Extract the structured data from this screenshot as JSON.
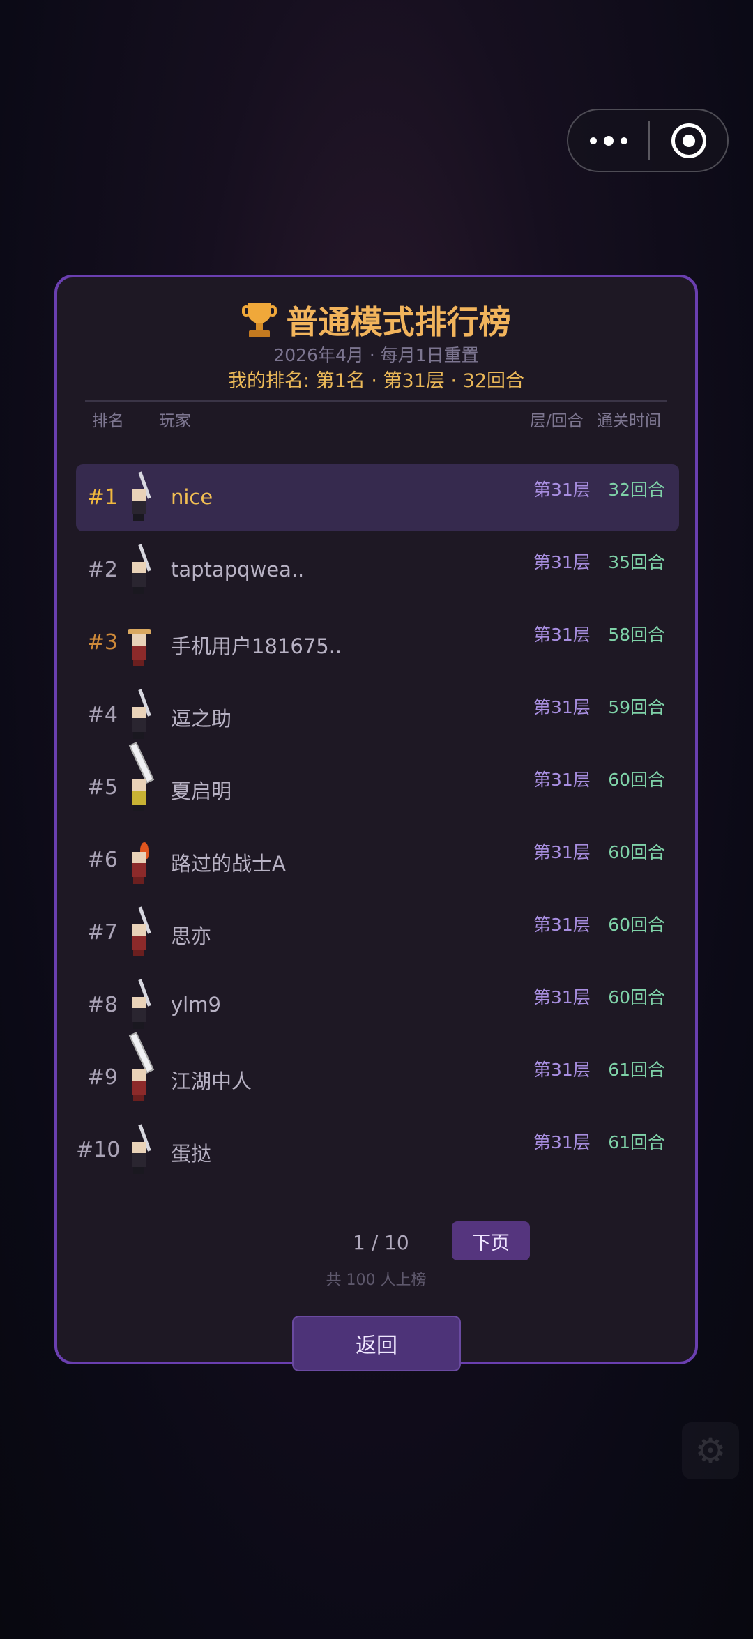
{
  "capsule": {
    "more_icon": "more-dots-icon",
    "close_icon": "target-close-icon"
  },
  "leaderboard": {
    "title": "普通模式排行榜",
    "subtitle": "2026年4月 · 每月1日重置",
    "my_rank": "我的排名: 第1名 · 第31层 · 32回合",
    "headers": {
      "rank": "排名",
      "player": "玩家",
      "floor": "层/回合",
      "time": "通关时间"
    },
    "rows": [
      {
        "rank": "#1",
        "name": "nice",
        "floor": "第31层",
        "round": "32回合"
      },
      {
        "rank": "#2",
        "name": "taptapqwea..",
        "floor": "第31层",
        "round": "35回合"
      },
      {
        "rank": "#3",
        "name": "手机用户181675..",
        "floor": "第31层",
        "round": "58回合"
      },
      {
        "rank": "#4",
        "name": "逗之助",
        "floor": "第31层",
        "round": "59回合"
      },
      {
        "rank": "#5",
        "name": "夏启明",
        "floor": "第31层",
        "round": "60回合"
      },
      {
        "rank": "#6",
        "name": "路过的战士A",
        "floor": "第31层",
        "round": "60回合"
      },
      {
        "rank": "#7",
        "name": "思亦",
        "floor": "第31层",
        "round": "60回合"
      },
      {
        "rank": "#8",
        "name": "ylm9",
        "floor": "第31层",
        "round": "60回合"
      },
      {
        "rank": "#9",
        "name": "江湖中人",
        "floor": "第31层",
        "round": "61回合"
      },
      {
        "rank": "#10",
        "name": "蛋挞",
        "floor": "第31层",
        "round": "61回合"
      }
    ],
    "page": "1 / 10",
    "next_label": "下页",
    "total": "共 100 人上榜",
    "back_label": "返回"
  },
  "colors": {
    "accent": "#6a3fb0",
    "gold": "#f2b45c",
    "floor": "#a88ee0",
    "round": "#7fd2a8"
  }
}
